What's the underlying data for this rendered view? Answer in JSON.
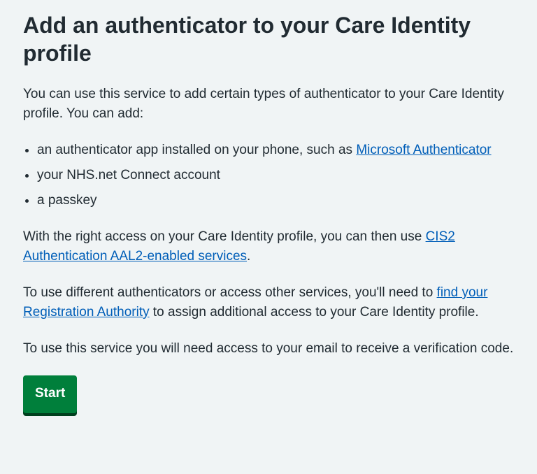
{
  "page": {
    "title": "Add an authenticator to your Care Identity profile",
    "intro": "You can use this service to add certain types of authenticator to your Care Identity profile. You can add:",
    "list": {
      "item1_prefix": "an authenticator app installed on your phone, such as ",
      "item1_link": "Microsoft Authenticator",
      "item2": "your NHS.net Connect account",
      "item3": "a passkey"
    },
    "para2_prefix": "With the right access on your Care Identity profile, you can then use ",
    "para2_link": "CIS2 Authentication AAL2-enabled services",
    "para2_suffix": ".",
    "para3_prefix": "To use different authenticators or access other services, you'll need to ",
    "para3_link": "find your Registration Authority",
    "para3_suffix": " to assign additional access to your Care Identity profile.",
    "para4": "To use this service you will need access to your email to receive a verification code.",
    "start_label": "Start"
  },
  "colors": {
    "background": "#f0f4f5",
    "text": "#212b32",
    "link": "#005eb8",
    "button": "#007f3b",
    "button_shadow": "#00401e"
  }
}
